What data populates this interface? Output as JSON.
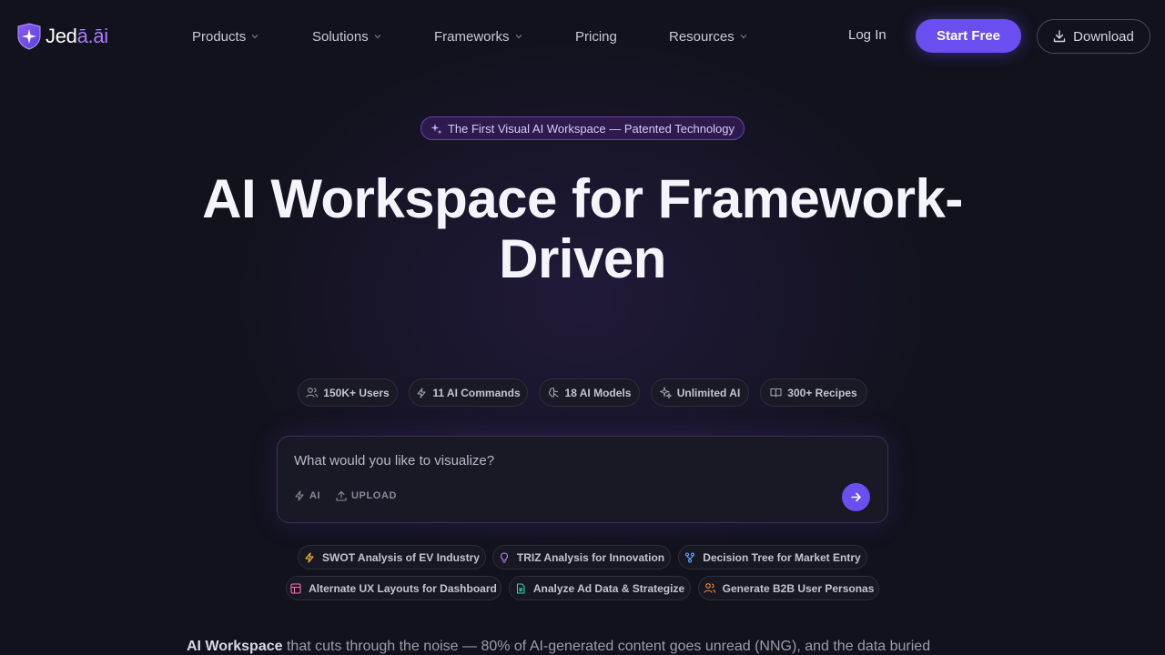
{
  "brand": {
    "name_part1": "Jed",
    "name_accent": "ā.āi"
  },
  "nav": {
    "items": [
      {
        "label": "Products",
        "dropdown": true
      },
      {
        "label": "Solutions",
        "dropdown": true
      },
      {
        "label": "Frameworks",
        "dropdown": true
      },
      {
        "label": "Pricing",
        "dropdown": false
      },
      {
        "label": "Resources",
        "dropdown": true
      }
    ],
    "login": "Log In",
    "start": "Start Free",
    "download": "Download"
  },
  "hero": {
    "badge": "The First Visual AI Workspace — Patented Technology",
    "title_line1": "AI Workspace for Framework-",
    "title_line2": "Driven"
  },
  "stats": [
    {
      "label": "150K+ Users",
      "icon": "users-icon"
    },
    {
      "label": "11 AI Commands",
      "icon": "bolt-icon"
    },
    {
      "label": "18 AI Models",
      "icon": "brain-icon"
    },
    {
      "label": "Unlimited AI",
      "icon": "sparkle-icon"
    },
    {
      "label": "300+ Recipes",
      "icon": "book-icon"
    }
  ],
  "prompt": {
    "placeholder": "What would you like to visualize?",
    "tool_ai": "AI",
    "tool_upload": "UPLOAD"
  },
  "suggestions": [
    {
      "label": "SWOT Analysis of EV Industry",
      "icon": "bolt-icon",
      "color": "#f0b429"
    },
    {
      "label": "TRIZ Analysis for Innovation",
      "icon": "lightbulb-icon",
      "color": "#c084fc"
    },
    {
      "label": "Decision Tree for Market Entry",
      "icon": "branch-icon",
      "color": "#60a5fa"
    },
    {
      "label": "Alternate UX Layouts for Dashboard",
      "icon": "layout-icon",
      "color": "#f472b6"
    },
    {
      "label": "Analyze Ad Data & Strategize",
      "icon": "sheet-icon",
      "color": "#34d399"
    },
    {
      "label": "Generate B2B User Personas",
      "icon": "users-icon",
      "color": "#fb923c"
    }
  ],
  "body": {
    "lead": "AI Workspace",
    "rest": " that cuts through the noise — 80% of AI-generated content goes unread (NNG), and the data buried"
  },
  "colors": {
    "accent": "#6a4ef0",
    "badge_border": "#6b3fb8"
  }
}
